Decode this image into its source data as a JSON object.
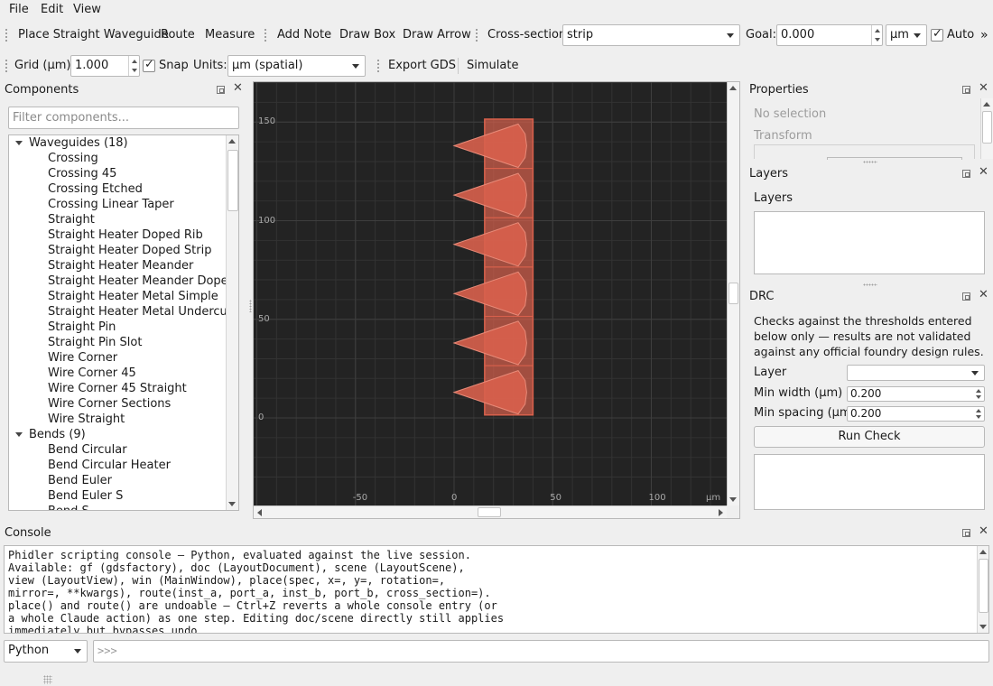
{
  "menu": [
    "File",
    "Edit",
    "View"
  ],
  "toolbar1": {
    "place_straight": "Place Straight Waveguide",
    "route": "Route",
    "measure": "Measure",
    "add_note": "Add Note",
    "draw_box": "Draw Box",
    "draw_arrow": "Draw Arrow",
    "cross_section_label": "Cross-section:",
    "cross_section_value": "strip",
    "goal_label": "Goal:",
    "goal_value": "0.000",
    "goal_unit": "µm",
    "auto_label": "Auto",
    "auto_checked": true,
    "overflow": "»"
  },
  "toolbar2": {
    "grid_label": "Grid (µm):",
    "grid_value": "1.000",
    "snap_label": "Snap",
    "snap_checked": true,
    "units_label": "Units:",
    "units_value": "µm  (spatial)",
    "export_gds": "Export GDS",
    "simulate": "Simulate"
  },
  "components": {
    "title": "Components",
    "filter_placeholder": "Filter components...",
    "categories": [
      {
        "label": "Waveguides (18)",
        "items": [
          "Crossing",
          "Crossing 45",
          "Crossing Etched",
          "Crossing Linear Taper",
          "Straight",
          "Straight Heater Doped Rib",
          "Straight Heater Doped Strip",
          "Straight Heater Meander",
          "Straight Heater Meander Doped",
          "Straight Heater Metal Simple",
          "Straight Heater Metal Undercut",
          "Straight Pin",
          "Straight Pin Slot",
          "Wire Corner",
          "Wire Corner 45",
          "Wire Corner 45 Straight",
          "Wire Corner Sections",
          "Wire Straight"
        ]
      },
      {
        "label": "Bends (9)",
        "items": [
          "Bend Circular",
          "Bend Circular Heater",
          "Bend Euler",
          "Bend Euler S",
          "Bend S"
        ]
      }
    ]
  },
  "canvas": {
    "y_ticks": [
      {
        "label": "150",
        "value": 150
      },
      {
        "label": "100",
        "value": 100
      },
      {
        "label": "50",
        "value": 50
      },
      {
        "label": "0",
        "value": 0
      }
    ],
    "x_ticks": [
      {
        "label": "-50",
        "value": -50
      },
      {
        "label": "0",
        "value": 0
      },
      {
        "label": "50",
        "value": 50
      },
      {
        "label": "100",
        "value": 100
      }
    ],
    "x_unit": "µm",
    "shape_color": "#d8614c",
    "cells": 6
  },
  "properties": {
    "title": "Properties",
    "no_selection": "No selection",
    "transform": "Transform"
  },
  "layers": {
    "title": "Layers",
    "heading": "Layers"
  },
  "drc": {
    "title": "DRC",
    "description": "Checks against the thresholds entered below only — results are not validated against any official foundry design rules.",
    "layer_label": "Layer",
    "layer_value": "",
    "min_width_label": "Min width (µm)",
    "min_width_value": "0.200",
    "min_spacing_label": "Min spacing (µm)",
    "min_spacing_value": "0.200",
    "run_check": "Run Check"
  },
  "console": {
    "title": "Console",
    "text": "Phidler scripting console — Python, evaluated against the live session.\nAvailable: gf (gdsfactory), doc (LayoutDocument), scene (LayoutScene),\nview (LayoutView), win (MainWindow), place(spec, x=, y=, rotation=,\nmirror=, **kwargs), route(inst_a, port_a, inst_b, port_b, cross_section=).\nplace() and route() are undoable — Ctrl+Z reverts a whole console entry (or\na whole Claude action) as one step. Editing doc/scene directly still applies\nimmediately but bypasses undo.",
    "language": "Python",
    "prompt": ">>>"
  }
}
